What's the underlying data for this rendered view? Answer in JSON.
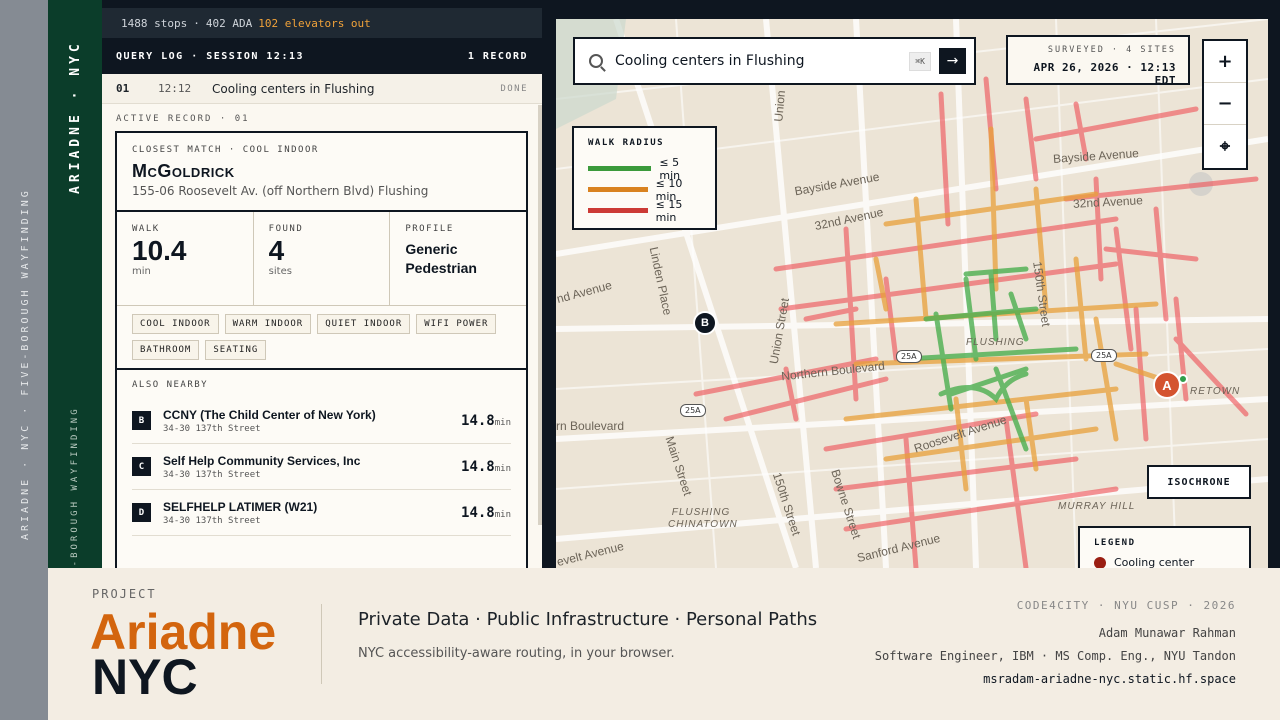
{
  "side": {
    "gray_text": "ARIADNE · NYC · FIVE-BOROUGH WAYFINDING",
    "brand": "ARIADNE · NYC",
    "green_sub": "FIVE-BOROUGH WAYFINDING"
  },
  "status": {
    "stops": "1488 stops",
    "ada": "402 ADA",
    "elevators": "102 elevators out",
    "sep": "·"
  },
  "query_log": {
    "title": "QUERY LOG · SESSION 12:13",
    "count": "1 RECORD",
    "rows": [
      {
        "num": "01",
        "time": "12:12",
        "query": "Cooling centers in Flushing",
        "status": "DONE"
      }
    ]
  },
  "active_record": {
    "label": "ACTIVE RECORD · 01",
    "match_label": "CLOSEST MATCH · COOL INDOOR",
    "name": "McGoldrick",
    "address": "155-06 Roosevelt Av. (off Northern Blvd) Flushing",
    "stats": [
      {
        "key": "WALK",
        "value": "10.4",
        "unit": "min"
      },
      {
        "key": "FOUND",
        "value": "4",
        "unit": "sites"
      },
      {
        "key": "PROFILE",
        "value_line1": "Generic",
        "value_line2": "Pedestrian"
      }
    ],
    "tags": [
      "COOL INDOOR",
      "WARM INDOOR",
      "QUIET INDOOR",
      "WIFI POWER",
      "BATHROOM",
      "SEATING"
    ],
    "nearby_label": "ALSO NEARBY",
    "nearby": [
      {
        "badge": "B",
        "name": "CCNY (The Child Center of New York)",
        "address": "34-30 137th Street",
        "dist": "14.8",
        "unit": "min"
      },
      {
        "badge": "C",
        "name": "Self Help Community Services, Inc",
        "address": "34-30 137th Street",
        "dist": "14.8",
        "unit": "min"
      },
      {
        "badge": "D",
        "name": "SELFHELP LATIMER (W21)",
        "address": "34-30 137th Street",
        "dist": "14.8",
        "unit": "min"
      }
    ]
  },
  "map": {
    "search_value": "Cooling centers in Flushing",
    "kbd": "⌘K",
    "go_icon": "→",
    "surveyed": "SURVEYED · 4 SITES",
    "datetime": "APR 26, 2026 · 12:13 EDT",
    "zoom_in": "+",
    "zoom_out": "−",
    "locate": "⌖",
    "walk_radius": {
      "title": "WALK RADIUS",
      "items": [
        {
          "label": "≤ 5 min",
          "color": "#3b9a3b"
        },
        {
          "label": "≤ 10 min",
          "color": "#d9821f"
        },
        {
          "label": "≤ 15 min",
          "color": "#cc3a35"
        }
      ]
    },
    "isochrone": "ISOCHRONE",
    "legend": {
      "title": "LEGEND",
      "item": "Cooling center"
    },
    "pin_a": "A",
    "pin_b": "B",
    "labels": {
      "bayside_ave_1": "Bayside Avenue",
      "bayside_ave_2": "Bayside Avenue",
      "st32_1": "32nd Avenue",
      "st32_2": "32nd Avenue",
      "linden": "Linden Place",
      "ave_left": "nd Avenue",
      "union1": "Union",
      "union2": "Union Street",
      "st150": "150th Street",
      "st150b": "150th Street",
      "northern": "Northern Boulevard",
      "blvd_left": "rn Boulevard",
      "main": "Main Street",
      "roosevelt": "Roosevelt Avenue",
      "bowne": "Bowne Street",
      "sanford": "Sanford Avenue",
      "velt": "evelt Avenue",
      "flushing": "FLUSHING",
      "chinatown": "FLUSHING CHINATOWN",
      "murray": "MURRAY HILL",
      "town": "RETOWN",
      "shield1": "25A",
      "shield2": "25A",
      "shield3": "25A"
    }
  },
  "footer": {
    "project": "PROJECT",
    "title1": "Ariadne",
    "title2": "NYC",
    "tagline": "Private Data · Public Infrastructure · Personal Paths",
    "sub": "NYC accessibility-aware routing, in your browser.",
    "credit1": "CODE4CITY · NYU CUSP · 2026",
    "credit2": "Adam Munawar Rahman",
    "credit3": "Software Engineer, IBM · MS Comp. Eng., NYU Tandon",
    "credit4": "msradam-ariadne-nyc.static.hf.space"
  },
  "colors": {
    "green5": "#3b9a3b",
    "orange10": "#d9821f",
    "red15": "#cc3a35",
    "brand_orange": "#d3650e",
    "sidebar_green": "#0b3d2a"
  }
}
